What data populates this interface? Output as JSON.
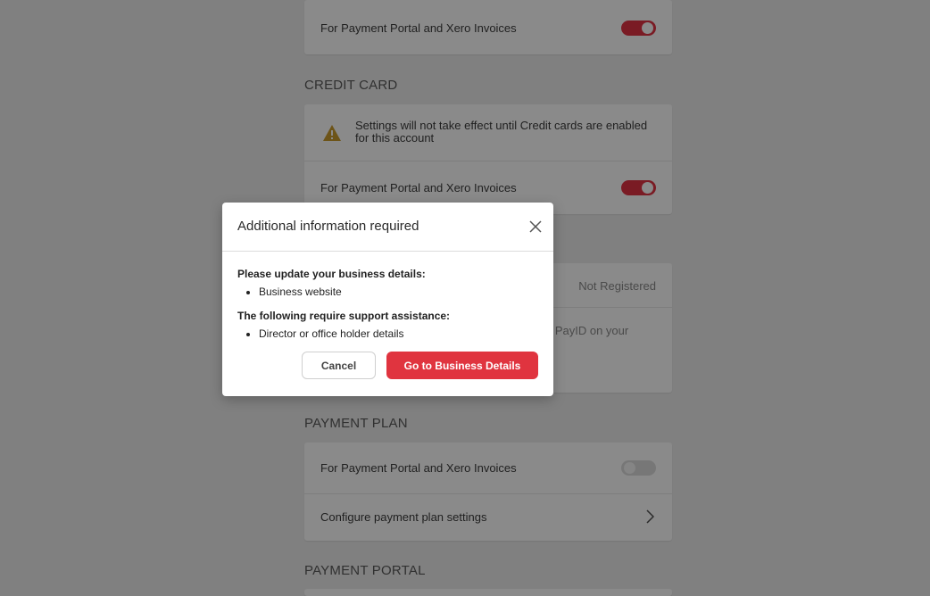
{
  "sections": {
    "top_card": {
      "label": "For Payment Portal and Xero Invoices",
      "toggle_state": "on"
    },
    "credit_card": {
      "title": "CREDIT CARD",
      "warning": "Settings will not take effect until Credit cards are enabled for this account",
      "label": "For Payment Portal and Xero Invoices",
      "toggle_state": "on"
    },
    "payid": {
      "status": "Not Registered",
      "partial_text": "g PayID on your"
    },
    "payment_plan": {
      "title": "PAYMENT PLAN",
      "label": "For Payment Portal and Xero Invoices",
      "toggle_state": "off",
      "configure_label": "Configure payment plan settings"
    },
    "payment_portal": {
      "title": "PAYMENT PORTAL"
    }
  },
  "modal": {
    "title": "Additional information required",
    "update_heading": "Please update your business details:",
    "update_items": [
      "Business website"
    ],
    "support_heading": "The following require support assistance:",
    "support_items": [
      "Director or office holder details"
    ],
    "cancel_label": "Cancel",
    "primary_label": "Go to Business Details"
  },
  "colors": {
    "toggle_on": "#7a1b24",
    "primary_button": "#e0343f",
    "warning": "#b07a10"
  }
}
